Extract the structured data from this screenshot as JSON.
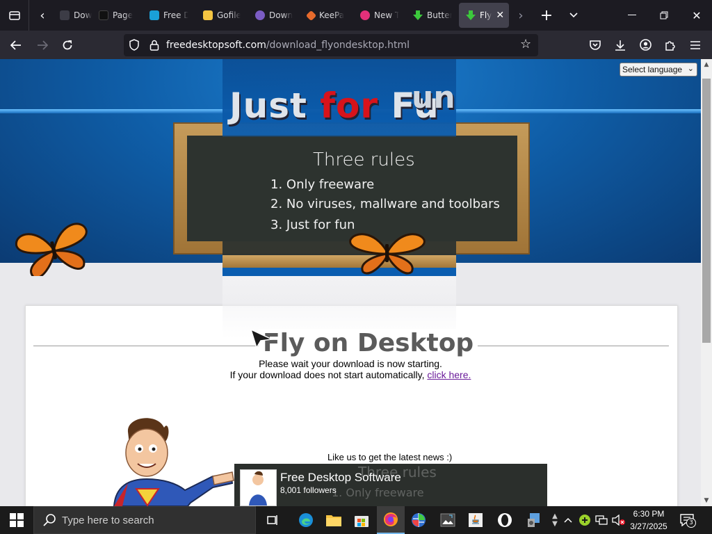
{
  "browser": {
    "tabs": [
      {
        "label": "Down",
        "favicon": "download-icon",
        "color": "#3c3c46"
      },
      {
        "label": "Page",
        "favicon": "page-icon",
        "color": "#111111"
      },
      {
        "label": "Free D",
        "favicon": "freedesktop-icon",
        "color": "#1aa0d8"
      },
      {
        "label": "Gofile",
        "favicon": "gofile-icon",
        "color": "#f4c542"
      },
      {
        "label": "Down",
        "favicon": "tor-icon",
        "color": "#7b5cc4"
      },
      {
        "label": "KeePa",
        "favicon": "keepass-icon",
        "color": "#e66a2c"
      },
      {
        "label": "New T",
        "favicon": "firefox-icon",
        "color": "#e3307a"
      },
      {
        "label": "Butter",
        "favicon": "download-arrow-icon",
        "color": "#3cc83c"
      },
      {
        "label": "Fly",
        "favicon": "download-arrow-icon",
        "color": "#3cc83c",
        "active": true
      }
    ],
    "url_host": "freedesktopsoft.com",
    "url_path": "/download_flyondesktop.html"
  },
  "page": {
    "language_select": "Select language",
    "hero_title_part1": "Just ",
    "hero_title_part2": "for",
    "hero_title_part3": " Fu",
    "hero_title_tail": "un",
    "board_heading": "Three rules",
    "rules": [
      "1. Only freeware",
      "2. No viruses, mallware and toolbars",
      "3. Just for fun"
    ],
    "title": "Fly on Desktop",
    "wait_text": "Please wait your download is now starting.",
    "fallback_text": "If your download does not start automatically,",
    "click_here": "click here.",
    "like_us": "Like us to get the latest news :)",
    "fb_name": "Free Desktop Software",
    "fb_followers": "8,001 followers",
    "fb_ghost_heading": "Three rules",
    "fb_ghost_rule": "1. Only freeware"
  },
  "taskbar": {
    "search_placeholder": "Type here to search",
    "time": "6:30 PM",
    "date": "3/27/2025",
    "notification_count": "3",
    "apps": [
      "edge-icon",
      "file-explorer-icon",
      "store-icon",
      "firefox-icon",
      "globe-app-icon",
      "image-app-icon",
      "java-icon",
      "opera-icon",
      "settings-app-icon"
    ]
  },
  "colors": {
    "accent_red": "#d7131b",
    "link_purple": "#6a1b9a",
    "hero_blue": "#0f5ea8",
    "board_green": "#2d332f"
  }
}
